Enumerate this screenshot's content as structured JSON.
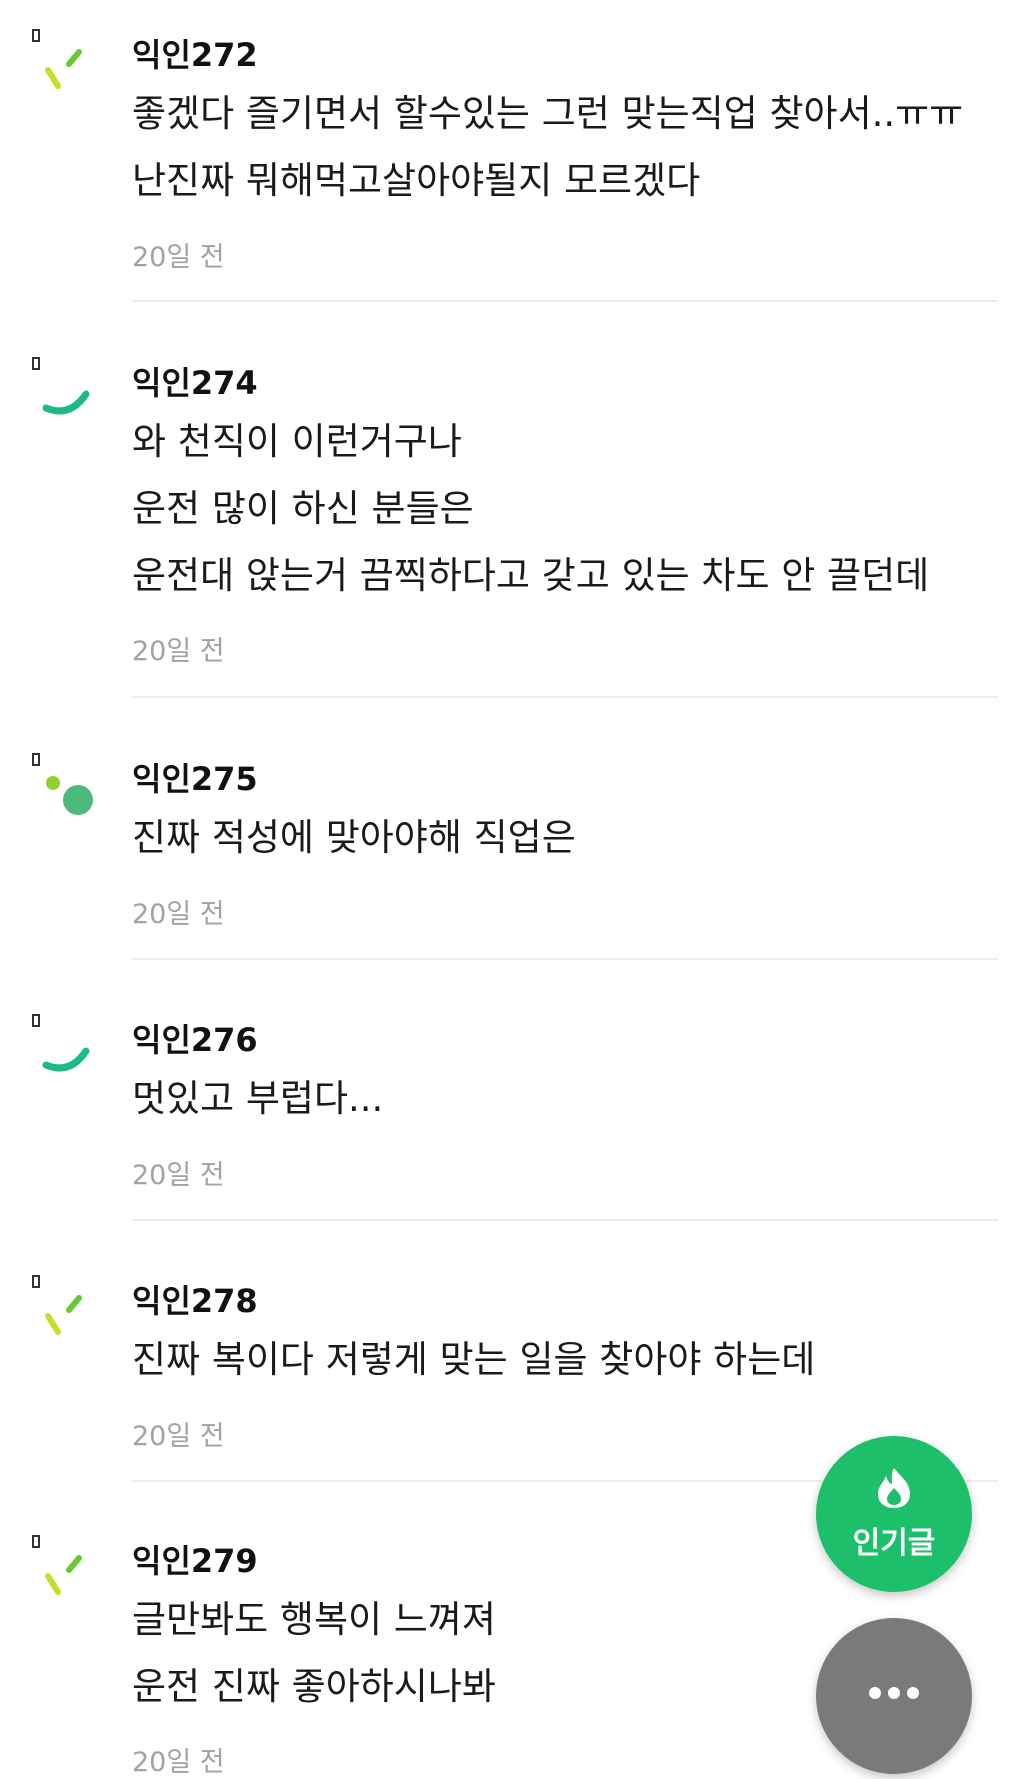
{
  "comments": [
    {
      "author": "익인272",
      "lines": [
        "좋겠다 즐기면서 할수있는 그런 맞는직업 찾아서..ㅠㅠ",
        "난진짜 뭐해먹고살아야될지 모르겠다"
      ],
      "time": "20일 전",
      "avatar_icon": "check-mark-icon",
      "avatar_color": "#c8dc2c"
    },
    {
      "author": "익인274",
      "lines": [
        "와 천직이 이런거구나",
        "운전 많이 하신 분들은",
        "운전대 앉는거 끔찍하다고 갖고 있는 차도 안 끌던데"
      ],
      "time": "20일 전",
      "avatar_icon": "smile-arc-icon",
      "avatar_color": "#1dbb84"
    },
    {
      "author": "익인275",
      "lines": [
        "진짜 적성에 맞아야해 직업은"
      ],
      "time": "20일 전",
      "avatar_icon": "two-dots-icon",
      "avatar_color": "#4cbb79"
    },
    {
      "author": "익인276",
      "lines": [
        "멋있고 부럽다..."
      ],
      "time": "20일 전",
      "avatar_icon": "smile-arc-icon",
      "avatar_color": "#1dbb84"
    },
    {
      "author": "익인278",
      "lines": [
        "진짜 복이다 저렇게 맞는 일을 찾아야 하는데"
      ],
      "time": "20일 전",
      "avatar_icon": "check-mark-icon",
      "avatar_color": "#c8dc2c"
    },
    {
      "author": "익인279",
      "lines": [
        "글만봐도 행복이 느껴져",
        "운전 진짜 좋아하시나봐"
      ],
      "time": "20일 전",
      "avatar_icon": "check-mark-icon",
      "avatar_color": "#c8dc2c"
    }
  ],
  "fab": {
    "popular_label": "인기글",
    "popular_icon": "fire-icon",
    "popular_color": "#1dbf6b",
    "more_icon": "more-dots-icon",
    "more_color": "#7a7a7a"
  }
}
